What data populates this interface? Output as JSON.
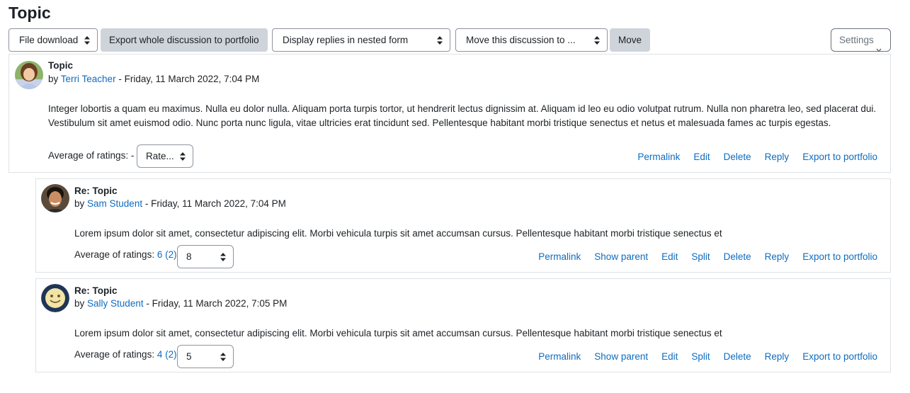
{
  "page": {
    "title": "Topic"
  },
  "toolbar": {
    "file_download": "File download",
    "export_whole": "Export whole discussion to portfolio",
    "display_mode": "Display replies in nested form",
    "move_to": "Move this discussion to ...",
    "move": "Move",
    "settings": "Settings"
  },
  "posts": [
    {
      "subject": "Topic",
      "by": "by",
      "author": "Terri Teacher",
      "date": " - Friday, 11 March 2022, 7:04 PM",
      "message": "Integer lobortis a quam eu maximus. Nulla eu dolor nulla. Aliquam porta turpis tortor, ut hendrerit lectus dignissim at. Aliquam id leo eu odio volutpat rutrum. Nulla non pharetra leo, sed placerat dui. Vestibulum sit amet euismod odio. Nunc porta nunc ligula, vitae ultricies erat tincidunt sed. Pellentesque habitant morbi tristique senectus et netus et malesuada fames ac turpis egestas.",
      "ratings_label": "Average of ratings:",
      "ratings_value": " - ",
      "ratings_count": "",
      "rate_select": "Rate...",
      "commands": [
        "Permalink",
        "Edit",
        "Delete",
        "Reply",
        "Export to portfolio"
      ]
    },
    {
      "subject": "Re: Topic",
      "by": "by",
      "author": "Sam Student",
      "date": " - Friday, 11 March 2022, 7:04 PM",
      "message": "Lorem ipsum dolor sit amet, consectetur adipiscing elit. Morbi vehicula turpis sit amet accumsan cursus. Pellentesque habitant morbi tristique senectus et",
      "ratings_label": "Average of ratings:",
      "ratings_value": "6",
      "ratings_count": "(2)",
      "rate_select": "8",
      "commands": [
        "Permalink",
        "Show parent",
        "Edit",
        "Split",
        "Delete",
        "Reply",
        "Export to portfolio"
      ]
    },
    {
      "subject": "Re: Topic",
      "by": "by",
      "author": "Sally Student",
      "date": " - Friday, 11 March 2022, 7:05 PM",
      "message": "Lorem ipsum dolor sit amet, consectetur adipiscing elit. Morbi vehicula turpis sit amet accumsan cursus. Pellentesque habitant morbi tristique senectus et",
      "ratings_label": "Average of ratings:",
      "ratings_value": "4",
      "ratings_count": "(2)",
      "rate_select": "5",
      "commands": [
        "Permalink",
        "Show parent",
        "Edit",
        "Split",
        "Delete",
        "Reply",
        "Export to portfolio"
      ]
    }
  ],
  "colors": {
    "link": "#0f6cbf",
    "button_grey": "#ced4da",
    "border": "#dee2e6"
  },
  "icons": {
    "select_caret": "sort-updown-icon",
    "settings_chevron": "chevron-down-icon"
  }
}
